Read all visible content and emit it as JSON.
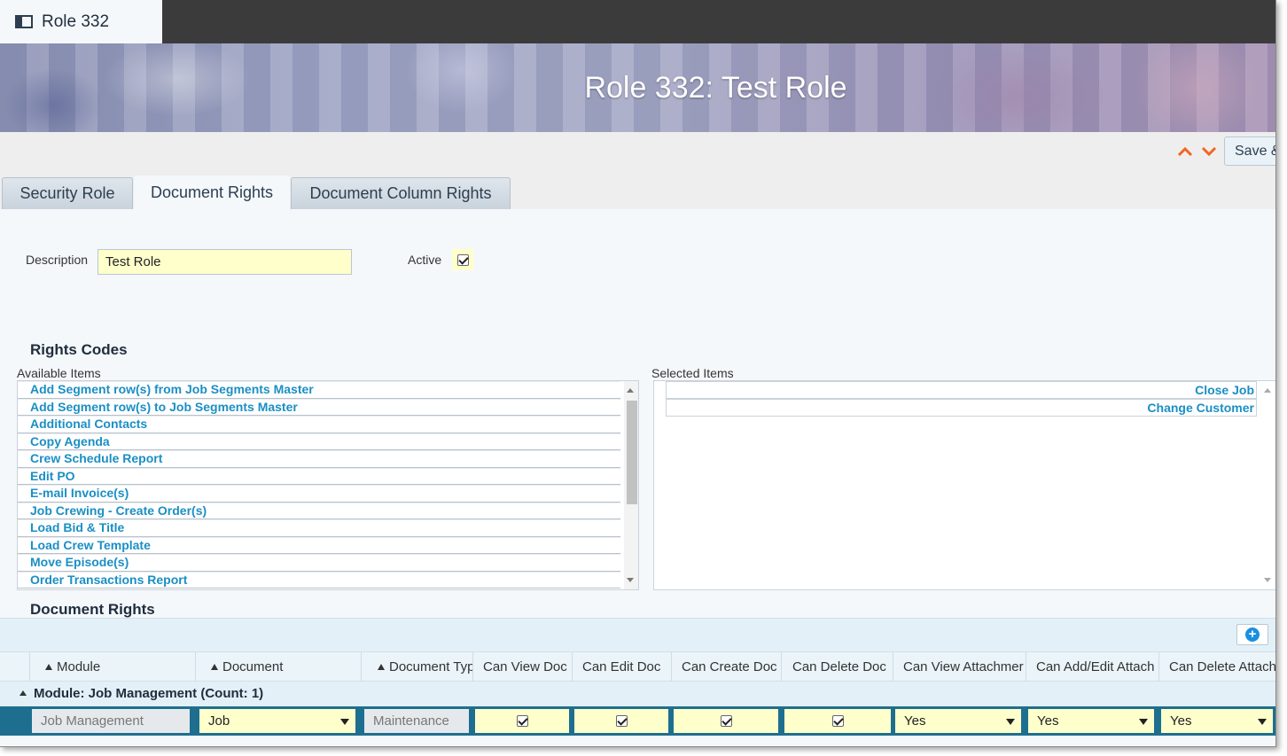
{
  "window": {
    "tab_title": "Role 332"
  },
  "page": {
    "heading": "Role 332: Test Role"
  },
  "toolbar": {
    "save_label": "Save &"
  },
  "tabs": [
    {
      "label": "Security Role"
    },
    {
      "label": "Document Rights"
    },
    {
      "label": "Document Column Rights"
    }
  ],
  "form": {
    "description_label": "Description",
    "description_value": "Test Role",
    "active_label": "Active",
    "active_checked": true
  },
  "rights_codes": {
    "title": "Rights Codes",
    "available_label": "Available Items",
    "selected_label": "Selected Items",
    "available_items": [
      "Add Segment row(s) from Job Segments Master",
      "Add Segment row(s) to Job Segments Master",
      "Additional Contacts",
      "Copy Agenda",
      "Crew Schedule Report",
      "Edit PO",
      "E-mail Invoice(s)",
      "Job Crewing - Create Order(s)",
      "Load Bid & Title",
      "Load Crew Template",
      "Move Episode(s)",
      "Order Transactions Report"
    ],
    "selected_items": [
      "Close Job",
      "Change Customer"
    ]
  },
  "document_rights": {
    "title": "Document Rights",
    "columns": [
      "Module",
      "Document",
      "Document Typ",
      "Can View Doc",
      "Can Edit Doc",
      "Can Create Doc",
      "Can Delete Doc",
      "Can View Attachmer",
      "Can Add/Edit Attach",
      "Can Delete Attach"
    ],
    "group_label": "Module: Job Management (Count: 1)",
    "row": {
      "module": "Job Management",
      "document": "Job",
      "document_type": "Maintenance",
      "can_view_doc": true,
      "can_edit_doc": true,
      "can_create_doc": true,
      "can_delete_doc": true,
      "can_view_attach": "Yes",
      "can_add_edit_attach": "Yes",
      "can_delete_attach": "Yes"
    }
  },
  "colors": {
    "accent_link": "#1a8fc4",
    "input_yellow": "#ffffcc",
    "row_selected": "#1e6f8f",
    "chevron_orange": "#f26522"
  },
  "icons": [
    "document-panel-icon",
    "chevron-up-icon",
    "chevron-down-icon",
    "add-circle-icon",
    "dropdown-arrow-icon"
  ]
}
